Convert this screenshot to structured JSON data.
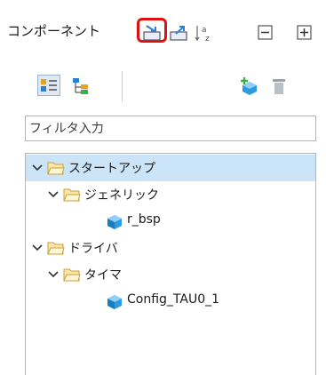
{
  "view": {
    "title": "コンポーネント",
    "toolbar": [
      {
        "name": "import-component-icon",
        "highlighted": true
      },
      {
        "name": "export-component-icon"
      },
      {
        "name": "sort-alphabetical-icon"
      },
      {
        "name": "collapse-all-icon"
      },
      {
        "name": "expand-all-icon"
      }
    ],
    "secondary_toolbar": [
      {
        "name": "category-view-icon"
      },
      {
        "name": "hierarchy-view-icon"
      },
      {
        "name": "add-component-icon"
      },
      {
        "name": "remove-component-icon"
      }
    ],
    "highlight_color": "#e01010"
  },
  "filter": {
    "placeholder": "フィルタ入力",
    "value": ""
  },
  "tree": {
    "selection_color": "#cce4f7",
    "nodes": [
      {
        "label": "スタートアップ",
        "type": "folder",
        "expanded": true,
        "selected": true
      },
      {
        "label": "ジェネリック",
        "type": "folder",
        "expanded": true
      },
      {
        "label": "r_bsp",
        "type": "component"
      },
      {
        "label": "ドライバ",
        "type": "folder",
        "expanded": true
      },
      {
        "label": "タイマ",
        "type": "folder",
        "expanded": true
      },
      {
        "label": "Config_TAU0_1",
        "type": "component"
      }
    ]
  }
}
